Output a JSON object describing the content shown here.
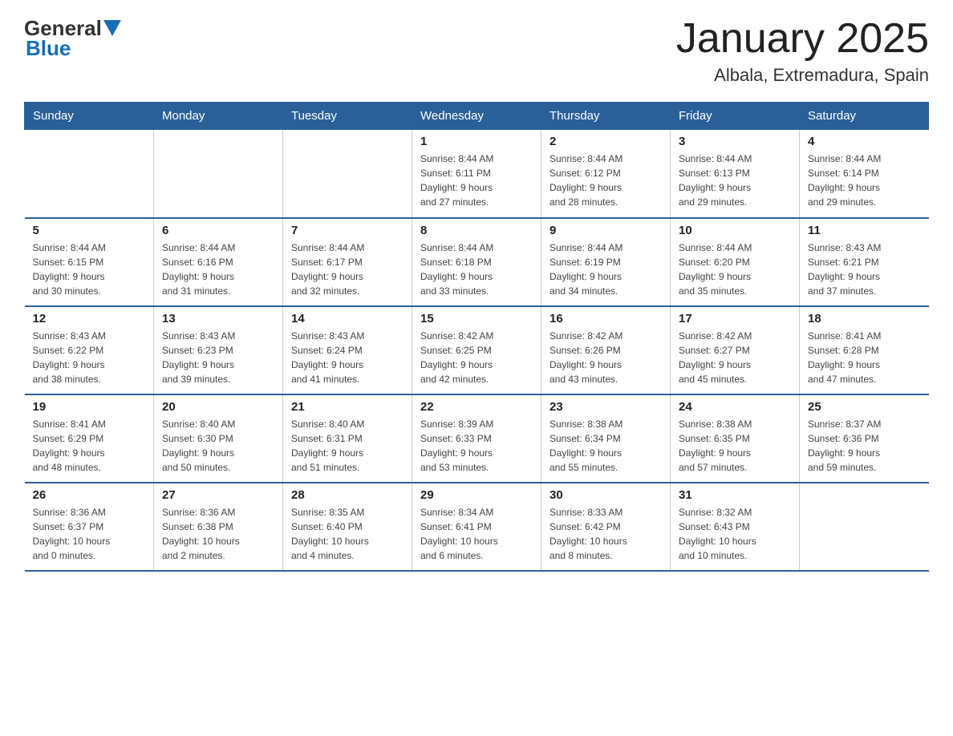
{
  "header": {
    "logo_general": "General",
    "logo_blue": "Blue",
    "month_title": "January 2025",
    "location": "Albala, Extremadura, Spain"
  },
  "weekdays": [
    "Sunday",
    "Monday",
    "Tuesday",
    "Wednesday",
    "Thursday",
    "Friday",
    "Saturday"
  ],
  "weeks": [
    [
      {
        "day": "",
        "info": ""
      },
      {
        "day": "",
        "info": ""
      },
      {
        "day": "",
        "info": ""
      },
      {
        "day": "1",
        "info": "Sunrise: 8:44 AM\nSunset: 6:11 PM\nDaylight: 9 hours\nand 27 minutes."
      },
      {
        "day": "2",
        "info": "Sunrise: 8:44 AM\nSunset: 6:12 PM\nDaylight: 9 hours\nand 28 minutes."
      },
      {
        "day": "3",
        "info": "Sunrise: 8:44 AM\nSunset: 6:13 PM\nDaylight: 9 hours\nand 29 minutes."
      },
      {
        "day": "4",
        "info": "Sunrise: 8:44 AM\nSunset: 6:14 PM\nDaylight: 9 hours\nand 29 minutes."
      }
    ],
    [
      {
        "day": "5",
        "info": "Sunrise: 8:44 AM\nSunset: 6:15 PM\nDaylight: 9 hours\nand 30 minutes."
      },
      {
        "day": "6",
        "info": "Sunrise: 8:44 AM\nSunset: 6:16 PM\nDaylight: 9 hours\nand 31 minutes."
      },
      {
        "day": "7",
        "info": "Sunrise: 8:44 AM\nSunset: 6:17 PM\nDaylight: 9 hours\nand 32 minutes."
      },
      {
        "day": "8",
        "info": "Sunrise: 8:44 AM\nSunset: 6:18 PM\nDaylight: 9 hours\nand 33 minutes."
      },
      {
        "day": "9",
        "info": "Sunrise: 8:44 AM\nSunset: 6:19 PM\nDaylight: 9 hours\nand 34 minutes."
      },
      {
        "day": "10",
        "info": "Sunrise: 8:44 AM\nSunset: 6:20 PM\nDaylight: 9 hours\nand 35 minutes."
      },
      {
        "day": "11",
        "info": "Sunrise: 8:43 AM\nSunset: 6:21 PM\nDaylight: 9 hours\nand 37 minutes."
      }
    ],
    [
      {
        "day": "12",
        "info": "Sunrise: 8:43 AM\nSunset: 6:22 PM\nDaylight: 9 hours\nand 38 minutes."
      },
      {
        "day": "13",
        "info": "Sunrise: 8:43 AM\nSunset: 6:23 PM\nDaylight: 9 hours\nand 39 minutes."
      },
      {
        "day": "14",
        "info": "Sunrise: 8:43 AM\nSunset: 6:24 PM\nDaylight: 9 hours\nand 41 minutes."
      },
      {
        "day": "15",
        "info": "Sunrise: 8:42 AM\nSunset: 6:25 PM\nDaylight: 9 hours\nand 42 minutes."
      },
      {
        "day": "16",
        "info": "Sunrise: 8:42 AM\nSunset: 6:26 PM\nDaylight: 9 hours\nand 43 minutes."
      },
      {
        "day": "17",
        "info": "Sunrise: 8:42 AM\nSunset: 6:27 PM\nDaylight: 9 hours\nand 45 minutes."
      },
      {
        "day": "18",
        "info": "Sunrise: 8:41 AM\nSunset: 6:28 PM\nDaylight: 9 hours\nand 47 minutes."
      }
    ],
    [
      {
        "day": "19",
        "info": "Sunrise: 8:41 AM\nSunset: 6:29 PM\nDaylight: 9 hours\nand 48 minutes."
      },
      {
        "day": "20",
        "info": "Sunrise: 8:40 AM\nSunset: 6:30 PM\nDaylight: 9 hours\nand 50 minutes."
      },
      {
        "day": "21",
        "info": "Sunrise: 8:40 AM\nSunset: 6:31 PM\nDaylight: 9 hours\nand 51 minutes."
      },
      {
        "day": "22",
        "info": "Sunrise: 8:39 AM\nSunset: 6:33 PM\nDaylight: 9 hours\nand 53 minutes."
      },
      {
        "day": "23",
        "info": "Sunrise: 8:38 AM\nSunset: 6:34 PM\nDaylight: 9 hours\nand 55 minutes."
      },
      {
        "day": "24",
        "info": "Sunrise: 8:38 AM\nSunset: 6:35 PM\nDaylight: 9 hours\nand 57 minutes."
      },
      {
        "day": "25",
        "info": "Sunrise: 8:37 AM\nSunset: 6:36 PM\nDaylight: 9 hours\nand 59 minutes."
      }
    ],
    [
      {
        "day": "26",
        "info": "Sunrise: 8:36 AM\nSunset: 6:37 PM\nDaylight: 10 hours\nand 0 minutes."
      },
      {
        "day": "27",
        "info": "Sunrise: 8:36 AM\nSunset: 6:38 PM\nDaylight: 10 hours\nand 2 minutes."
      },
      {
        "day": "28",
        "info": "Sunrise: 8:35 AM\nSunset: 6:40 PM\nDaylight: 10 hours\nand 4 minutes."
      },
      {
        "day": "29",
        "info": "Sunrise: 8:34 AM\nSunset: 6:41 PM\nDaylight: 10 hours\nand 6 minutes."
      },
      {
        "day": "30",
        "info": "Sunrise: 8:33 AM\nSunset: 6:42 PM\nDaylight: 10 hours\nand 8 minutes."
      },
      {
        "day": "31",
        "info": "Sunrise: 8:32 AM\nSunset: 6:43 PM\nDaylight: 10 hours\nand 10 minutes."
      },
      {
        "day": "",
        "info": ""
      }
    ]
  ]
}
